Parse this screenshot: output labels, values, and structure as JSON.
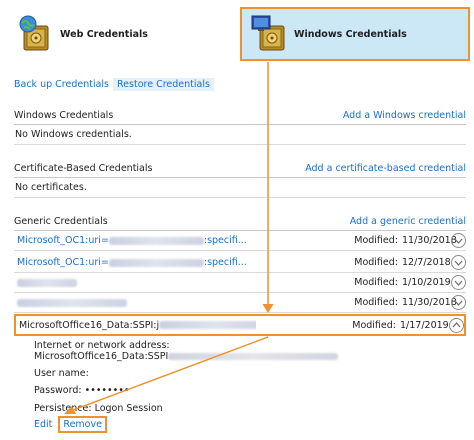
{
  "header": {
    "tabs": [
      {
        "label": "Web Credentials",
        "icon": "vault-globe-icon",
        "selected": false
      },
      {
        "label": "Windows Credentials",
        "icon": "vault-monitor-icon",
        "selected": true
      }
    ]
  },
  "links": {
    "backup": "Back up Credentials",
    "restore": "Restore Credentials"
  },
  "windows": {
    "title": "Windows Credentials",
    "add": "Add a Windows credential",
    "empty": "No Windows credentials."
  },
  "certificate": {
    "title": "Certificate-Based Credentials",
    "add": "Add a certificate-based credential",
    "empty": "No certificates."
  },
  "generic": {
    "title": "Generic Credentials",
    "add": "Add a generic credential",
    "modified_label": "Modified:",
    "rows": [
      {
        "name_start": "Microsoft_OC1:uri=",
        "name_end": ":specifi...",
        "date": "11/30/2018"
      },
      {
        "name_start": "Microsoft_OC1:uri=",
        "name_end": ":specifi...",
        "date": "12/7/2018"
      },
      {
        "name_start": "",
        "name_end": "",
        "date": "1/10/2019"
      },
      {
        "name_start": "",
        "name_end": "",
        "date": "11/30/2018"
      },
      {
        "name_start": "MicrosoftOffice16_Data:SSPI:j",
        "name_end": "",
        "date": "1/17/2019"
      }
    ]
  },
  "detail": {
    "address_label": "Internet or network address:",
    "address_value": "MicrosoftOffice16_Data:SSPI",
    "username_label": "User name:",
    "password_label": "Password:",
    "password_value": "••••••••",
    "persistence_label": "Persistence:",
    "persistence_value": "Logon Session",
    "edit": "Edit",
    "remove": "Remove"
  },
  "colors": {
    "accent": "#f0912e",
    "link": "#1a6fc7",
    "selected_tab": "#cce8f7"
  }
}
